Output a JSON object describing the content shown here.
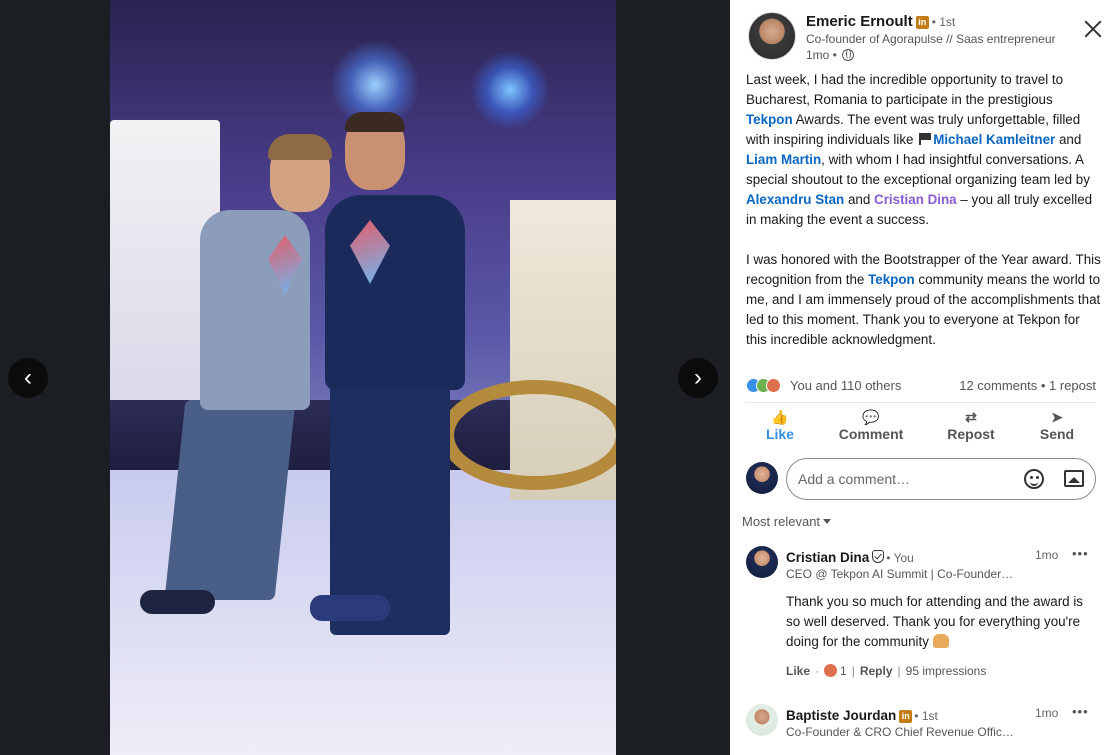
{
  "viewer": {
    "prev_label": "‹",
    "next_label": "›"
  },
  "post": {
    "author_name": "Emeric Ernoult",
    "author_badge": "in",
    "author_degree": "• 1st",
    "author_headline": "Co-founder of Agorapulse // Saas entrepreneur",
    "post_time": "1mo •",
    "body": {
      "p1_a": "Last week, I had the incredible opportunity to travel to Bucharest, Romania to participate in the prestigious ",
      "p1_mention_tekpon": "Tekpon",
      "p1_b": " Awards. The event was truly unforgettable, filled with inspiring individuals like ",
      "p1_mention_michael": "Michael Kamleitner",
      "p1_c": " and ",
      "p1_mention_liam": "Liam Martin",
      "p1_d": ", with whom I had insightful conversations. A special shoutout to the exceptional organizing team led by ",
      "p1_mention_alexandru": "Alexandru Stan",
      "p1_e": " and ",
      "p1_mention_cristian": "Cristian Dina",
      "p1_f": " – you all truly excelled in making the event a success.",
      "p2_a": "I was honored with the Bootstrapper of the Year award. This recognition from the ",
      "p2_mention_tekpon": "Tekpon",
      "p2_b": " community means the world to me, and I am immensely proud of the accomplishments that led to this moment. Thank you to everyone at Tekpon for this incredible acknowledgment."
    },
    "reactions_text": "You and 110 others",
    "comments_text": "12 comments • 1 repost"
  },
  "actions": {
    "like": "Like",
    "comment": "Comment",
    "repost": "Repost",
    "send": "Send",
    "like_icon": "👍",
    "comment_icon": "💬",
    "repost_icon": "⇄",
    "send_icon": "➤"
  },
  "composer": {
    "placeholder": "Add a comment…"
  },
  "sort": {
    "label": "Most relevant"
  },
  "comments": [
    {
      "name": "Cristian Dina",
      "meta": "• You",
      "headline": "CEO @ Tekpon AI Summit | Co-Founder @ Tekpon",
      "time": "1mo",
      "more": "•••",
      "text": "Thank you so much for attending and the award is so well deserved. Thank you for everything you're doing for the community",
      "like": "Like",
      "reaction_count": "1",
      "reply": "Reply",
      "impressions": "95 impressions"
    },
    {
      "name": "Baptiste Jourdan",
      "badge": "in",
      "meta": "• 1st",
      "headline": "Co-Founder & CRO Chief Revenue Officer @ Agorapulse",
      "time": "1mo",
      "more": "•••"
    }
  ],
  "colors": {
    "link_blue": "#0a66c2",
    "mention_purple": "#8a5cd1",
    "like_blue": "#378fe9",
    "linkedin_badge": "#c37d16"
  }
}
